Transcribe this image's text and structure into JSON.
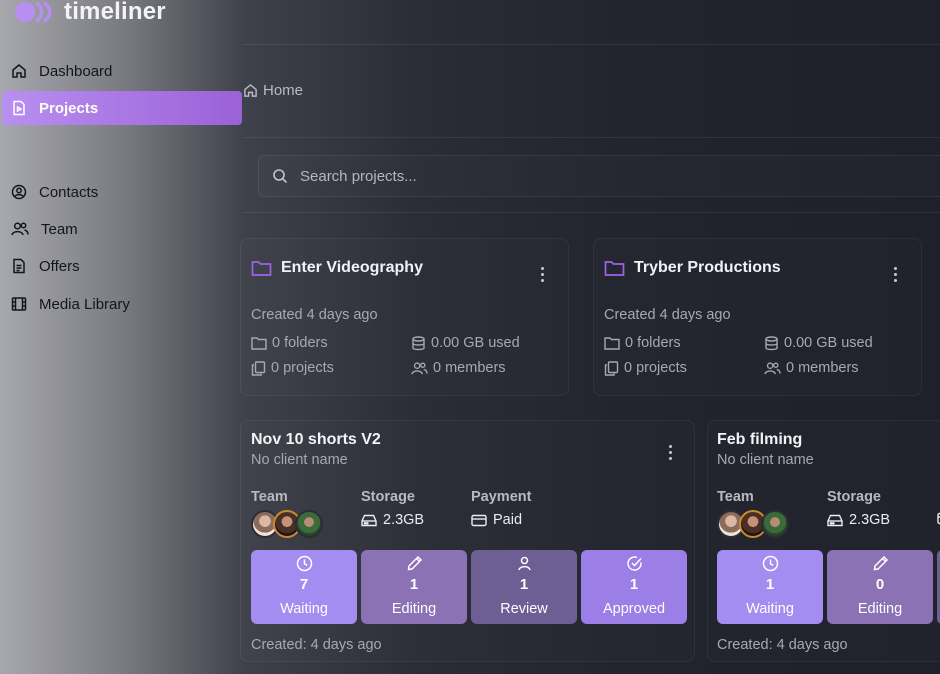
{
  "app": {
    "name": "timeliner"
  },
  "sidebar": {
    "items": [
      {
        "label": "Dashboard",
        "icon": "home-icon"
      },
      {
        "label": "Projects",
        "icon": "file-play-icon",
        "active": true
      },
      {
        "label": "Contacts",
        "icon": "user-circle-icon"
      },
      {
        "label": "Team",
        "icon": "users-icon"
      },
      {
        "label": "Offers",
        "icon": "document-icon"
      },
      {
        "label": "Media Library",
        "icon": "film-icon"
      }
    ]
  },
  "breadcrumb": {
    "home_label": "Home"
  },
  "search": {
    "placeholder": "Search projects..."
  },
  "folders": [
    {
      "title": "Enter Videography",
      "created": "Created 4 days ago",
      "folders": "0 folders",
      "storage": "0.00 GB used",
      "projects": "0 projects",
      "members": "0 members"
    },
    {
      "title": "Tryber Productions",
      "created": "Created 4 days ago",
      "folders": "0 folders",
      "storage": "0.00 GB used",
      "projects": "0 projects",
      "members": "0 members"
    }
  ],
  "projects": [
    {
      "title": "Nov 10 shorts V2",
      "client": "No client name",
      "labels": {
        "team": "Team",
        "storage": "Storage",
        "payment": "Payment"
      },
      "storage": "2.3GB",
      "payment": "Paid",
      "tiles": [
        {
          "count": "7",
          "label": "Waiting"
        },
        {
          "count": "1",
          "label": "Editing"
        },
        {
          "count": "1",
          "label": "Review"
        },
        {
          "count": "1",
          "label": "Approved"
        }
      ],
      "created": "Created: 4 days ago"
    },
    {
      "title": "Feb filming",
      "client": "No client name",
      "labels": {
        "team": "Team",
        "storage": "Storage"
      },
      "storage": "2.3GB",
      "tiles": [
        {
          "count": "1",
          "label": "Waiting"
        },
        {
          "count": "0",
          "label": "Editing"
        }
      ],
      "created": "Created: 4 days ago"
    }
  ],
  "colors": {
    "accent": "#9b61d8",
    "folder_icon": "#a262e8",
    "tile_waiting": "#a48cf0",
    "tile_editing": "#8a72b4",
    "tile_review": "#6f5e94",
    "tile_approved": "#9b7ee6"
  }
}
